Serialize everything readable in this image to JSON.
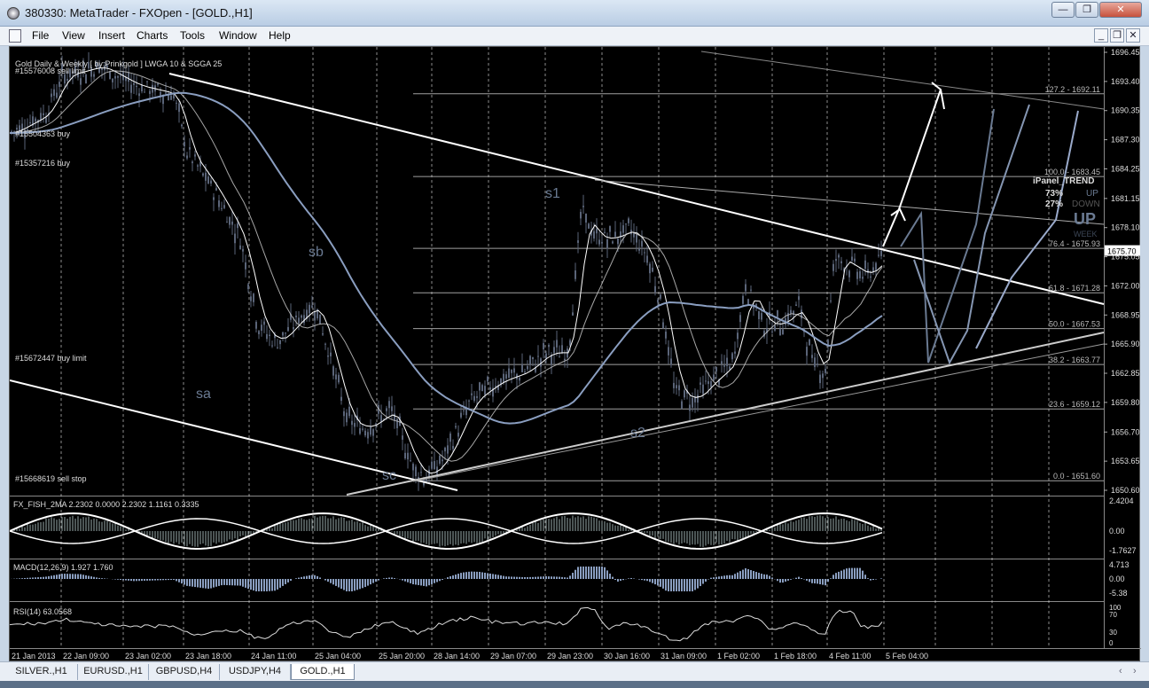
{
  "window": {
    "title": "380330: MetaTrader - FXOpen - [GOLD.,H1]",
    "buttons": [
      "—",
      "❐",
      "✕"
    ],
    "mdi_buttons": [
      "_",
      "❐",
      "✕"
    ]
  },
  "menu": [
    "File",
    "View",
    "Insert",
    "Charts",
    "Tools",
    "Window",
    "Help"
  ],
  "chart": {
    "info": "Gold Daily & Weekly [ by:Prinkgold ] LWGA 10  &  SGGA 25",
    "orders": [
      "#15576008 sell limit",
      "#15504363 buy",
      "#15357216 buy",
      "#15672447 buy limit",
      "#15668619 sell stop"
    ],
    "annotations": [
      "s1",
      "sb",
      "sa",
      "s2",
      "sc"
    ],
    "price_axis": [
      "1696.45",
      "1693.40",
      "1690.35",
      "1687.30",
      "1684.25",
      "1681.15",
      "1678.10",
      "1675.05",
      "1672.00",
      "1668.95",
      "1665.90",
      "1662.85",
      "1659.80",
      "1656.70",
      "1653.65",
      "1650.60"
    ],
    "current_price": "1675.70",
    "fib_levels": [
      "127.2 - 1692.11",
      "100.0 - 1683.45",
      "76.4 - 1675.93",
      "61.8 - 1671.28",
      "50.0 - 1667.53",
      "38.2 - 1663.77",
      "23.6 - 1659.12",
      "0.0 - 1651.60"
    ],
    "ipanel": {
      "title": "iPanel_TREND",
      "up_pct": "73%",
      "down_pct": "27%",
      "up_label": "UP",
      "down_label": "DOWN",
      "big_label": "UP",
      "week_label": "WEEK"
    },
    "time_axis": [
      "21 Jan 2013",
      "22 Jan 09:00",
      "23 Jan 02:00",
      "23 Jan 18:00",
      "24 Jan 11:00",
      "25 Jan 04:00",
      "25 Jan 20:00",
      "28 Jan 14:00",
      "29 Jan 07:00",
      "29 Jan 23:00",
      "30 Jan 16:00",
      "31 Jan 09:00",
      "1 Feb 02:00",
      "1 Feb 18:00",
      "4 Feb 11:00",
      "5 Feb 04:00"
    ]
  },
  "indicators": {
    "fisher": {
      "label": "FX_FISH_2MA 2.2302 0.0000 2.2302 1.1161 0.3335",
      "scale": [
        "2.4204",
        "0.00",
        "-1.7627"
      ]
    },
    "macd": {
      "label": "MACD(12,26,9) 1.927 1.760",
      "scale": [
        "4.713",
        "0.00",
        "-5.38"
      ]
    },
    "rsi": {
      "label": "RSI(14) 63.0568",
      "scale": [
        "100",
        "70",
        "30",
        "0"
      ]
    }
  },
  "tabs": [
    "SILVER.,H1",
    "EURUSD.,H1",
    "GBPUSD,H4",
    "USDJPY,H4",
    "GOLD.,H1"
  ],
  "active_tab": "GOLD.,H1",
  "colors": {
    "background": "#000000",
    "grid": "#ffffff",
    "candle": "#5a6478",
    "ma_white": "#ffffff",
    "ma_blue": "#8a9ec0"
  }
}
